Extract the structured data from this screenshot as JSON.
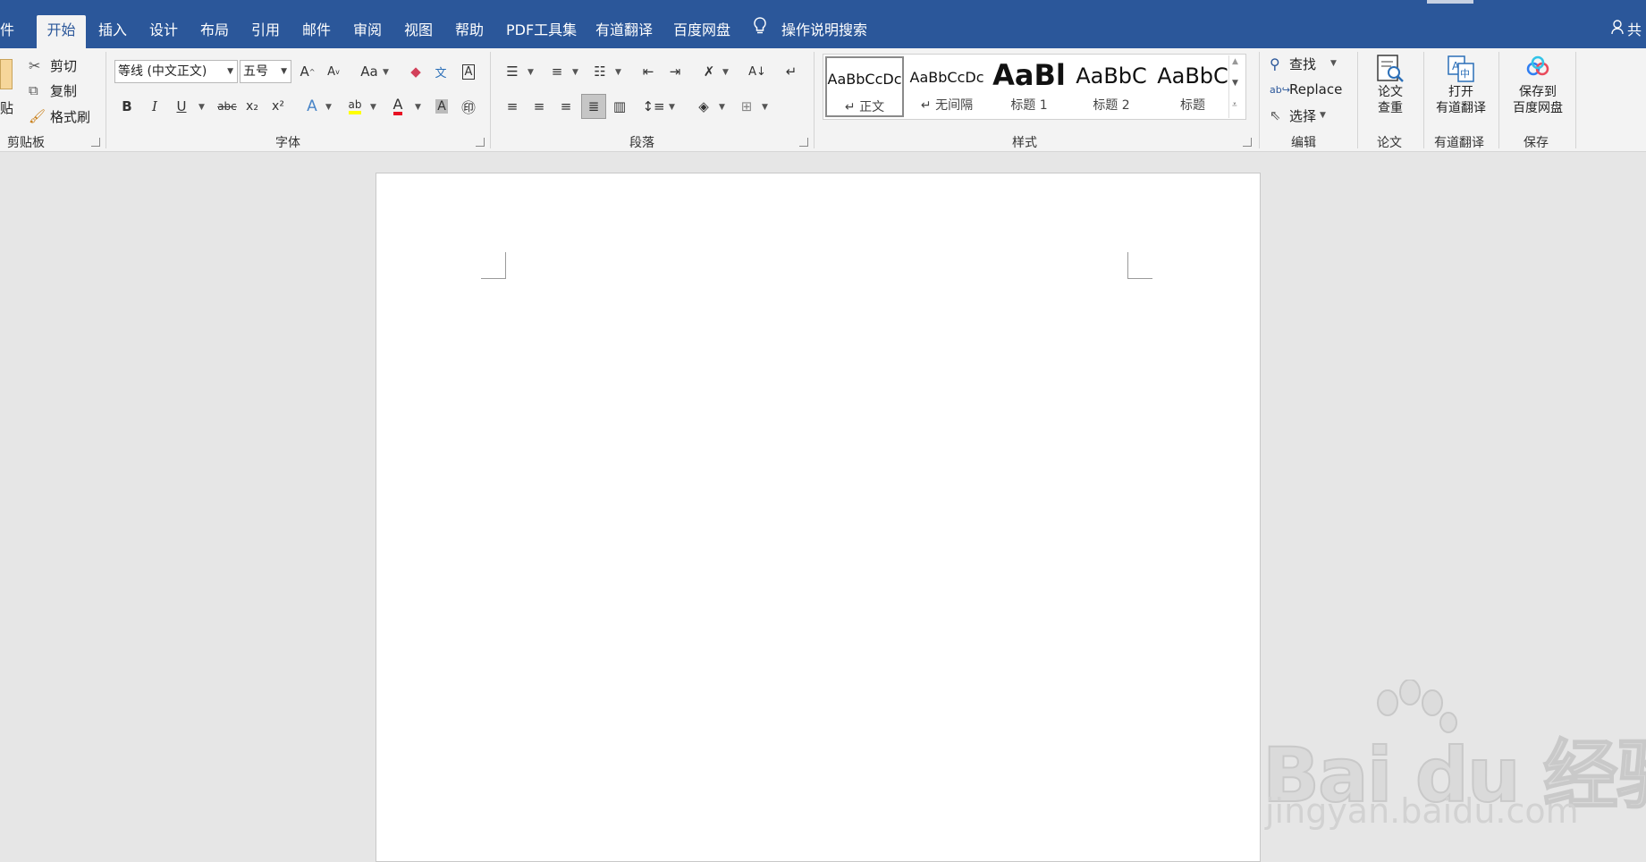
{
  "tabs": [
    {
      "label": "件"
    },
    {
      "label": "开始"
    },
    {
      "label": "插入"
    },
    {
      "label": "设计"
    },
    {
      "label": "布局"
    },
    {
      "label": "引用"
    },
    {
      "label": "邮件"
    },
    {
      "label": "审阅"
    },
    {
      "label": "视图"
    },
    {
      "label": "帮助"
    },
    {
      "label": "PDF工具集"
    },
    {
      "label": "有道翻译"
    },
    {
      "label": "百度网盘"
    }
  ],
  "tell_me": "操作说明搜索",
  "share": "共",
  "clipboard": {
    "paste": "贴",
    "cut": "剪切",
    "copy": "复制",
    "format_painter": "格式刷",
    "group": "剪贴板"
  },
  "font": {
    "name": "等线 (中文正文)",
    "size": "五号",
    "change_case": "Aa",
    "bold": "B",
    "italic": "I",
    "underline": "U",
    "strike": "abc",
    "sub": "x₂",
    "sup": "x²",
    "color_a": "A",
    "group": "字体"
  },
  "paragraph": {
    "group": "段落"
  },
  "styles": {
    "items": [
      {
        "sample": "AaBbCcDc",
        "name": "↵ 正文"
      },
      {
        "sample": "AaBbCcDc",
        "name": "↵ 无间隔"
      },
      {
        "sample": "AaBl",
        "name": "标题 1"
      },
      {
        "sample": "AaBbC",
        "name": "标题 2"
      },
      {
        "sample": "AaBbC",
        "name": "标题"
      }
    ],
    "group": "样式"
  },
  "editing": {
    "find": "查找",
    "replace": "Replace",
    "select": "选择",
    "group": "编辑"
  },
  "paper": {
    "label1": "论文",
    "label2": "查重",
    "group": "论文"
  },
  "youdao": {
    "label1": "打开",
    "label2": "有道翻译",
    "group": "有道翻译"
  },
  "baidu": {
    "label1": "保存到",
    "label2": "百度网盘",
    "group": "保存"
  },
  "watermark": {
    "main": "Bai du 经验",
    "url": "jingyan.baidu.com"
  },
  "colors": {
    "tabbar": "#2b579a",
    "highlight": "#ffff00",
    "font_color": "#e81123",
    "ribbon": "#f3f3f3"
  }
}
